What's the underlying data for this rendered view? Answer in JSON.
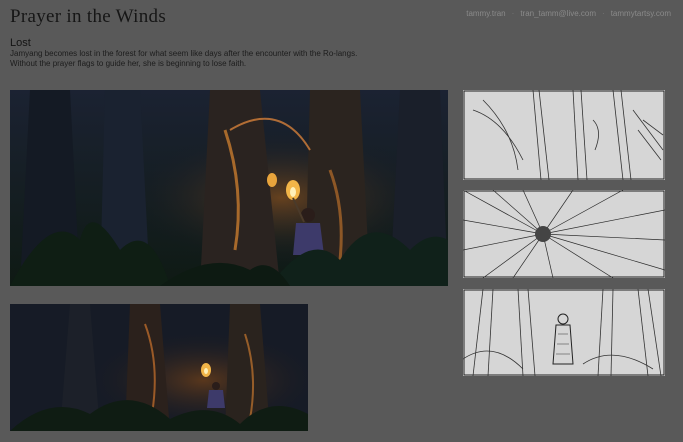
{
  "header": {
    "title": "Prayer in the Winds",
    "contact": {
      "name": "tammy.tran",
      "email": "tran_tamm@live.com",
      "site": "tammytartsy.com"
    }
  },
  "section": {
    "title": "Lost",
    "description_line1": "Jamyang becomes lost in the forest for what seem like days after the encounter with the Ro-langs.",
    "description_line2": "Without the prayer flags to guide her, she is beginning to lose faith."
  }
}
